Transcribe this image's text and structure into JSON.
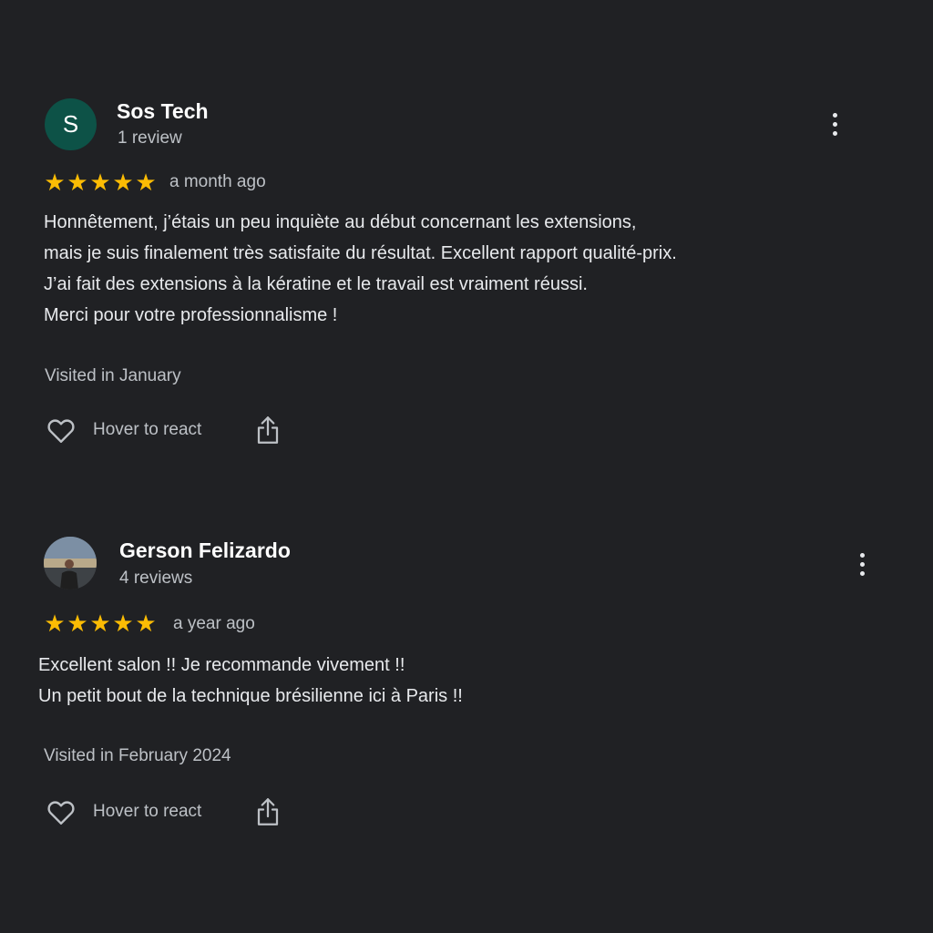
{
  "reviews": [
    {
      "avatar_letter": "S",
      "name": "Sos Tech",
      "review_count": "1 review",
      "rating": 5,
      "time_ago": "a month ago",
      "lines": [
        "Honnêtement, j’étais un peu inquiète au début concernant les extensions,",
        "mais je suis finalement très satisfaite du résultat. Excellent rapport qualité-prix.",
        "J’ai fait des extensions à la kératine et le travail est vraiment réussi.",
        "Merci pour votre professionnalisme !"
      ],
      "visited": "Visited in January",
      "react_label": "Hover to react"
    },
    {
      "name": "Gerson Felizardo",
      "review_count": "4 reviews",
      "rating": 5,
      "time_ago": "a year ago",
      "lines": [
        "Excellent salon !! Je recommande vivement !!",
        "Un petit bout de la technique brésilienne ici à Paris !!"
      ],
      "visited": "Visited in February 2024",
      "react_label": "Hover to react"
    }
  ],
  "icons": {
    "star": "star-icon",
    "heart": "heart-outline-icon",
    "share": "share-icon",
    "more": "more-vertical-icon"
  },
  "colors": {
    "background": "#202124",
    "star": "#fbbc04",
    "avatar_bg": "#0d5247"
  }
}
